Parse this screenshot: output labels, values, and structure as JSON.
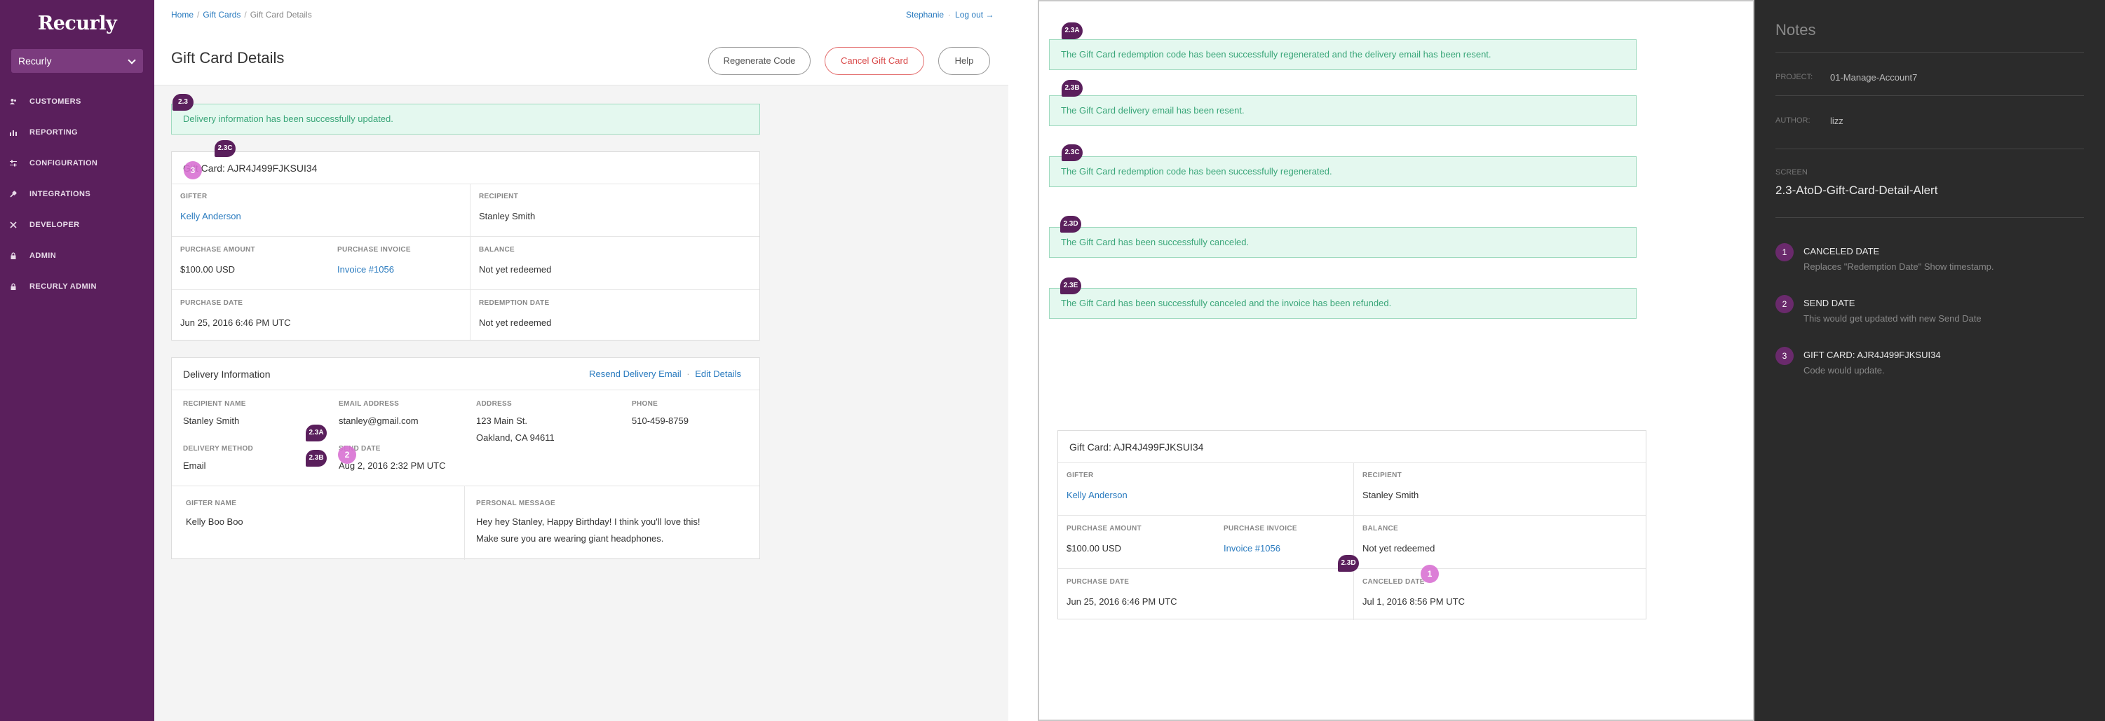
{
  "sidebar": {
    "logo": "Recurly",
    "site_select": "Recurly",
    "items": [
      {
        "label": "CUSTOMERS"
      },
      {
        "label": "REPORTING"
      },
      {
        "label": "CONFIGURATION"
      },
      {
        "label": "INTEGRATIONS"
      },
      {
        "label": "DEVELOPER"
      },
      {
        "label": "ADMIN"
      },
      {
        "label": "RECURLY ADMIN"
      }
    ]
  },
  "header": {
    "breadcrumb": [
      "Home",
      "Gift Cards",
      "Gift Card Details"
    ],
    "user": "Stephanie",
    "logout": "Log out",
    "logout_arrow": "→",
    "title": "Gift Card Details",
    "buttons": {
      "regenerate": "Regenerate Code",
      "cancel": "Cancel Gift Card",
      "help": "Help"
    }
  },
  "alert": {
    "tag": "2.3",
    "text": "Delivery information has been successfully updated."
  },
  "gift_card": {
    "title": "Gift Card: AJR4J499FJKSUI34",
    "tag": "2.3C",
    "dot": "3",
    "gifter_label": "GIFTER",
    "gifter": "Kelly Anderson",
    "recipient_label": "RECIPIENT",
    "recipient": "Stanley Smith",
    "purchase_amount_label": "PURCHASE AMOUNT",
    "purchase_amount": "$100.00 USD",
    "purchase_invoice_label": "PURCHASE INVOICE",
    "purchase_invoice": "Invoice #1056",
    "balance_label": "BALANCE",
    "balance": "Not yet redeemed",
    "purchase_date_label": "PURCHASE DATE",
    "purchase_date": "Jun 25, 2016 6:46 PM UTC",
    "redemption_date_label": "REDEMPTION DATE",
    "redemption_date": "Not yet redeemed"
  },
  "delivery": {
    "title": "Delivery Information",
    "resend": "Resend Delivery Email",
    "sep": "·",
    "edit": "Edit Details",
    "recipient_name_label": "RECIPIENT NAME",
    "recipient_name": "Stanley Smith",
    "email_label": "EMAIL ADDRESS",
    "email": "stanley@gmail.com",
    "address_label": "ADDRESS",
    "address_line1": "123 Main St.",
    "address_line2": "Oakland, CA 94611",
    "phone_label": "PHONE",
    "phone": "510-459-8759",
    "method_label": "DELIVERY METHOD",
    "method": "Email",
    "send_date_label": "SEND DATE",
    "send_date": "Aug 2, 2016 2:32 PM UTC",
    "tag_a": "2.3A",
    "tag_b": "2.3B",
    "dot": "2",
    "gifter_name_label": "GIFTER NAME",
    "gifter_name": "Kelly Boo Boo",
    "message_label": "PERSONAL MESSAGE",
    "message_line1": "Hey hey Stanley, Happy Birthday! I think you'll love this!",
    "message_line2": "Make sure you are wearing giant headphones."
  },
  "variants": {
    "alerts": [
      {
        "tag": "2.3A",
        "text": "The Gift Card redemption code has been successfully regenerated and the delivery email has been resent."
      },
      {
        "tag": "2.3B",
        "text": "The Gift Card delivery email has been resent."
      },
      {
        "tag": "2.3C",
        "text": "The Gift Card redemption code has been successfully regenerated."
      },
      {
        "tag": "2.3D",
        "text": "The Gift Card has been successfully canceled."
      },
      {
        "tag": "2.3E",
        "text": "The Gift Card has been successfully canceled and the invoice has been refunded."
      }
    ],
    "card": {
      "title": "Gift Card: AJR4J499FJKSUI34",
      "gifter_label": "GIFTER",
      "gifter": "Kelly Anderson",
      "recipient_label": "RECIPIENT",
      "recipient": "Stanley Smith",
      "purchase_amount_label": "PURCHASE AMOUNT",
      "purchase_amount": "$100.00 USD",
      "purchase_invoice_label": "PURCHASE INVOICE",
      "purchase_invoice": "Invoice #1056",
      "balance_label": "BALANCE",
      "balance": "Not yet redeemed",
      "purchase_date_label": "PURCHASE DATE",
      "purchase_date": "Jun 25, 2016 6:46 PM UTC",
      "canceled_date_label": "CANCELED DATE",
      "canceled_date": "Jul 1, 2016 8:56 PM UTC",
      "tag": "2.3D",
      "dot": "1"
    }
  },
  "notes": {
    "title": "Notes",
    "project_label": "PROJECT:",
    "project": "01-Manage-Account7",
    "author_label": "AUTHOR:",
    "author": "lizz",
    "screen_label": "SCREEN",
    "screen": "2.3-AtoD-Gift-Card-Detail-Alert",
    "items": [
      {
        "num": "1",
        "title": "CANCELED DATE",
        "desc": "Replaces \"Redemption Date\" Show timestamp."
      },
      {
        "num": "2",
        "title": "SEND DATE",
        "desc": "This would get updated with new Send Date"
      },
      {
        "num": "3",
        "title": "GIFT CARD: AJR4J499FJKSUI34",
        "desc": "Code would update."
      }
    ]
  },
  "colors": {
    "sidebar_bg": "#5a1f5c",
    "link": "#2a7bbf",
    "success_bg": "#e4f8ef",
    "success_text": "#3aa679",
    "danger": "#d94a4a",
    "notes_bg": "#2b2b2b",
    "annotation_dot": "#d972d3"
  },
  "icons": [
    "chevron-down-icon",
    "users-icon",
    "chart-icon",
    "sliders-icon",
    "plug-icon",
    "tools-icon",
    "lock-icon",
    "lock-icon",
    "arrow-right-icon"
  ]
}
